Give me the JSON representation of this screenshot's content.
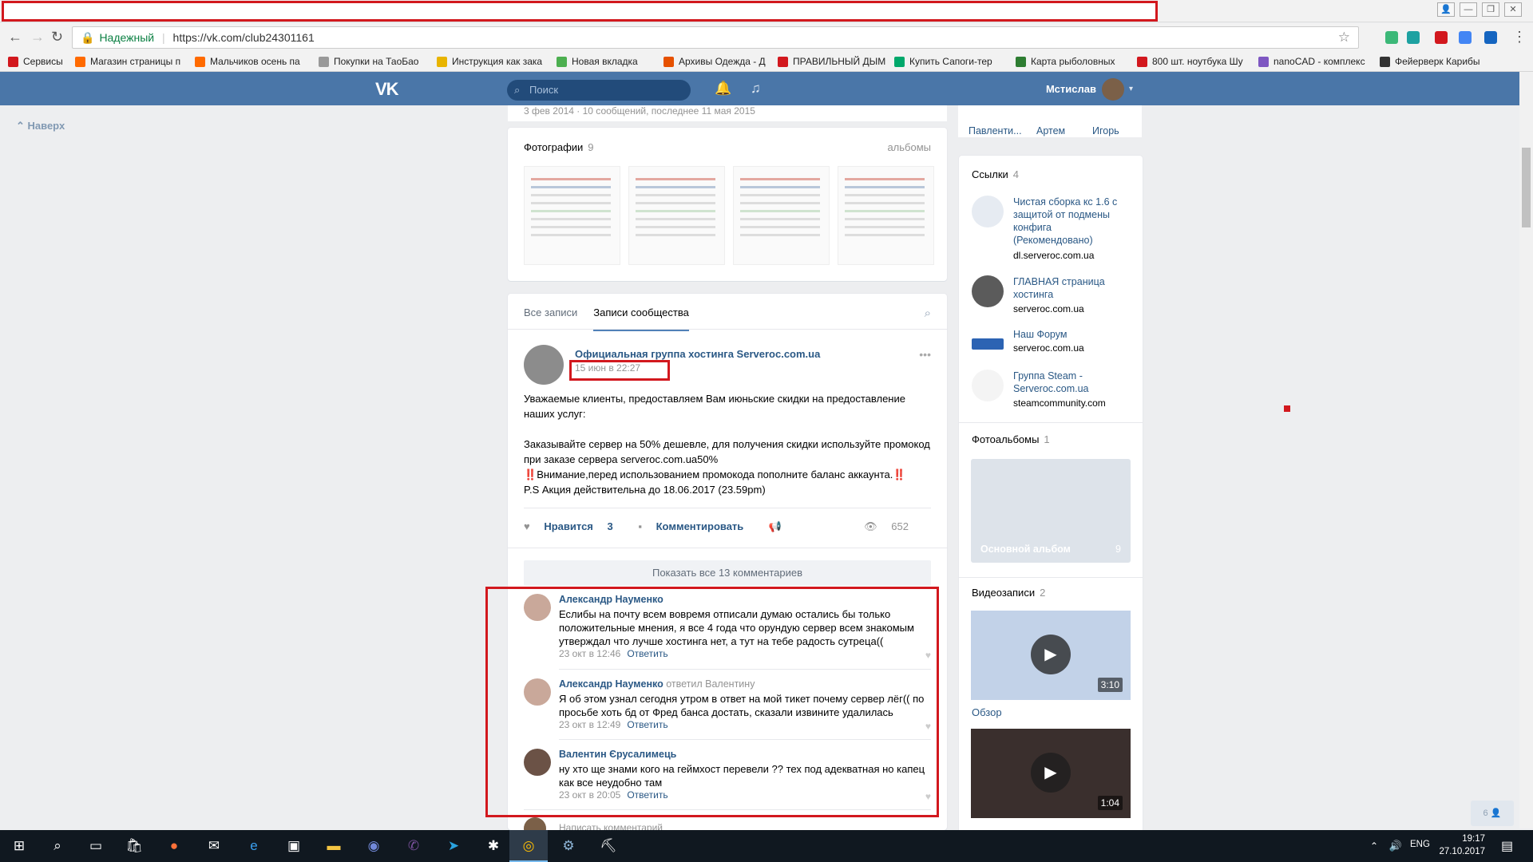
{
  "browser": {
    "secure_label": "Надежный",
    "url": "https://vk.com/club24301161",
    "bookmarks": [
      {
        "label": "Сервисы",
        "color": "#d2181e"
      },
      {
        "label": "Магазин страницы п",
        "color": "#ff6a00"
      },
      {
        "label": "Мальчиков осень па",
        "color": "#ff6a00"
      },
      {
        "label": "Покупки на ТаоБао",
        "color": "#999999"
      },
      {
        "label": "Инструкция как зака",
        "color": "#e8b400"
      },
      {
        "label": "Новая вкладка",
        "color": "#4caf50"
      },
      {
        "label": "Архивы Одежда - Д",
        "color": "#e65100"
      },
      {
        "label": "ПРАВИЛЬНЫЙ ДЫМ",
        "color": "#d2181e"
      },
      {
        "label": "Купить Сапоги-тер",
        "color": "#00a86b"
      },
      {
        "label": "Карта рыболовных",
        "color": "#2e7d32"
      },
      {
        "label": "800 шт. ноутбука Шу",
        "color": "#d2181e"
      },
      {
        "label": "nanoCAD - комплекс",
        "color": "#7e57c2"
      },
      {
        "label": "Фейерверк Карибы",
        "color": "#333333"
      }
    ]
  },
  "vk": {
    "logo": "VK",
    "search_placeholder": "Поиск",
    "user_name": "Мстислав",
    "to_top": "Наверх",
    "accent": "#4a76a8"
  },
  "topics_meta": "3 фев 2014 · 10 сообщений, последнее 11 мая 2015",
  "photos": {
    "title": "Фотографии",
    "count": "9",
    "albums_link": "альбомы"
  },
  "wall": {
    "tab_all": "Все записи",
    "tab_community": "Записи сообщества",
    "post": {
      "author": "Официальная группа хостинга Serveroc.com.ua",
      "date": "15 июн в 22:27",
      "line1": "Уважаемые клиенты, предоставляем Вам июньские скидки на предоставление наших услуг:",
      "line2": "Заказывайте сервер на 50% дешевле, для получения скидки используйте промокод при заказе сервера serveroc.com.ua50%",
      "line3": "Внимание,перед использованием промокода пополните баланс аккаунта.",
      "warn_glyph": "‼️",
      "line4": "P.S Акция действительна до 18.06.2017 (23.59pm)",
      "like_label": "Нравится",
      "like_count": "3",
      "comment_label": "Комментировать",
      "views": "652",
      "show_all": "Показать все 13 комментариев"
    },
    "comments": [
      {
        "name": "Александр Науменко",
        "reply_to": "",
        "text": "Еслибы на почту всем вовремя отписали думаю остались бы только положительные мнения, я все 4 года что орундую сервер всем знакомым утверждал что лучше хостинга нет, а тут на тебе радость сутреца((",
        "time": "23 окт в 12:46",
        "reply": "Ответить"
      },
      {
        "name": "Александр Науменко",
        "reply_to": "ответил Валентину",
        "text": "Я об этом узнал сегодня утром в ответ на мой тикет почему сервер лёг(( по просьбе хоть бд от Фред банса достать, сказали извините удалилась",
        "time": "23 окт в 12:49",
        "reply": "Ответить"
      },
      {
        "name": "Валентин Єрусалимець",
        "reply_to": "",
        "text": "ну хто ще знами кого на геймхост перевели ?? тех под адекватная но капец как все неудобно там",
        "time": "23 окт в 20:05",
        "reply": "Ответить"
      }
    ],
    "write_comment": "Написать комментарий"
  },
  "friends": [
    "Павленти...",
    "Артем",
    "Игорь"
  ],
  "sidebar": {
    "links_title": "Ссылки",
    "links_count": "4",
    "links": [
      {
        "title": "Чистая сборка кс 1.6 с защитой от подмены конфига (Рекомендовано)",
        "url": "dl.serveroc.com.ua"
      },
      {
        "title": "ГЛАВНАЯ страница хостинга",
        "url": "serveroc.com.ua"
      },
      {
        "title": "Наш Форум",
        "url": "serveroc.com.ua"
      },
      {
        "title": "Группа Steam - Serveroc.com.ua",
        "url": "steamcommunity.com"
      }
    ],
    "albums_title": "Фотоальбомы",
    "albums_count": "1",
    "album_name": "Основной альбом",
    "album_count": "9",
    "videos_title": "Видеозаписи",
    "videos_count": "2",
    "video1_duration": "3:10",
    "video1_name": "Обзор",
    "video2_duration": "1:04"
  },
  "online_count": "6",
  "taskbar": {
    "lang": "ENG",
    "time": "19:17",
    "date": "27.10.2017"
  }
}
